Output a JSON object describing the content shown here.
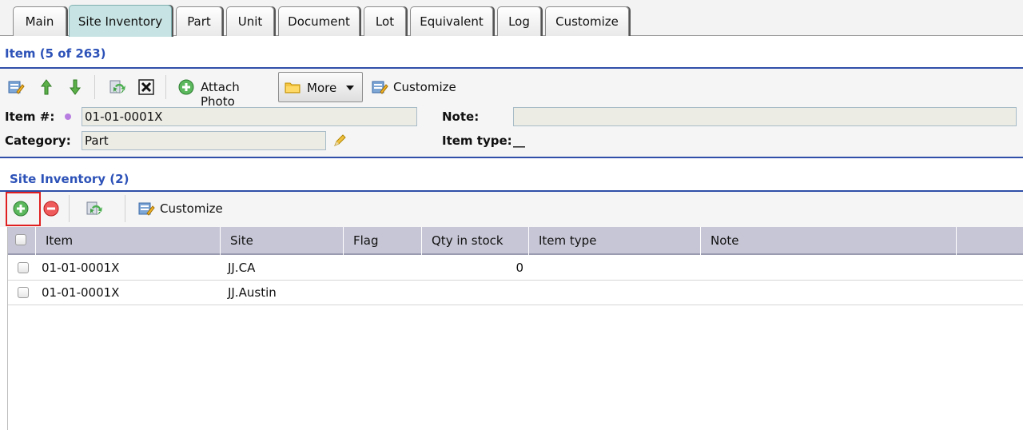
{
  "tabs": [
    {
      "label": "Main",
      "active": false
    },
    {
      "label": "Site Inventory",
      "active": true
    },
    {
      "label": "Part",
      "active": false
    },
    {
      "label": "Unit",
      "active": false
    },
    {
      "label": "Document",
      "active": false
    },
    {
      "label": "Lot",
      "active": false
    },
    {
      "label": "Equivalent",
      "active": false
    },
    {
      "label": "Log",
      "active": false
    },
    {
      "label": "Customize",
      "active": false
    }
  ],
  "item_section": {
    "title": "Item (5 of 263)",
    "toolbar": {
      "attach_photo": "Attach Photo",
      "more": "More",
      "customize": "Customize"
    },
    "form": {
      "item_no_label": "Item #:",
      "item_no_value": "01-01-0001X",
      "category_label": "Category:",
      "category_value": "Part",
      "note_label": "Note:",
      "note_value": "",
      "item_type_label": "Item type:",
      "item_type_value": "__"
    }
  },
  "site_inventory": {
    "title": "Site Inventory (2)",
    "toolbar": {
      "customize": "Customize"
    },
    "columns": [
      "Item",
      "Site",
      "Flag",
      "Qty in stock",
      "Item type",
      "Note"
    ],
    "rows": [
      {
        "item": "01-01-0001X",
        "site": "JJ.CA",
        "flag": "",
        "qty": "0",
        "item_type": "",
        "note": ""
      },
      {
        "item": "01-01-0001X",
        "site": "JJ.Austin",
        "flag": "",
        "qty": "",
        "item_type": "",
        "note": ""
      }
    ]
  },
  "colors": {
    "section_title": "#2d52b8",
    "active_tab": "#c8e3e3",
    "grid_header": "#c6c6d6",
    "highlight_box": "#e02020",
    "required_dot": "#b87de0"
  },
  "icons": [
    "edit-icon",
    "arrow-up-icon",
    "arrow-down-icon",
    "refresh-icon",
    "close-box-icon",
    "add-circle-icon",
    "folder-icon",
    "dropdown-arrow-icon",
    "customize-icon",
    "pencil-icon",
    "add-green-icon",
    "remove-red-icon"
  ]
}
